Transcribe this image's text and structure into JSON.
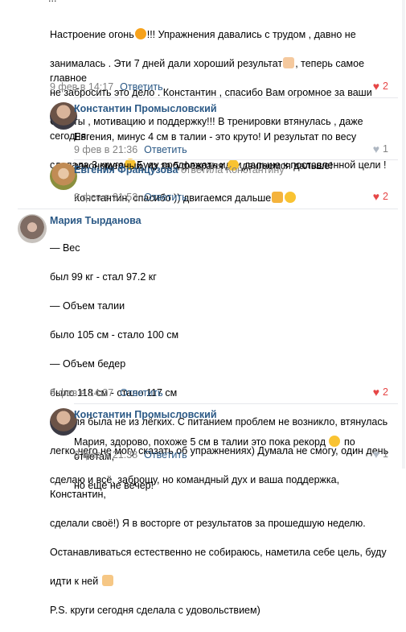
{
  "post_top": {
    "text_fragment": "...",
    "text_lines": [
      "Настроение огонь",
      "!!! Упражнения давались с трудом , давно не",
      "занималась . Эти 7 дней дали хороший результат",
      ", теперь самое главное",
      "не забросить это дело . Константин , спасибо Вам огромное за ваши",
      "Советы , мотивацию и поддержку!!! В тренировки втянулась , даже сегодня",
      "сделала 3 круга",
      "Буду продолжать идти дальше к поставленной цели !"
    ],
    "date": "9 фев в 14:17",
    "reply_label": "Ответить",
    "likes": "2"
  },
  "comment1": {
    "author": "Константин Промысловский",
    "line1": "Евгения, минус 4 см в талии - это круто! И результат по весу",
    "line2a": "закономерный, из за 5 февраля",
    "line2b": "двигаемся дальше!",
    "date": "9 фев в 21:36",
    "reply_label": "Ответить",
    "likes": "1"
  },
  "comment2": {
    "author": "Евгения Французова",
    "replied_to": "ответила Константину",
    "text_a": "Константин, спасибо )) двигаемся дальше",
    "date": "9 фев в 21:53",
    "reply_label": "Ответить",
    "likes": "2"
  },
  "comment3": {
    "author": "Мария Тырданова",
    "lines": [
      "— Вес",
      "был 99 кг - стал 97.2 кг",
      "— Объем талии",
      "было 105 см - стало 100 см",
      "— Объем бедер",
      "было 118 см - стало 117 см",
      "Неделя была не из лёгких. С питанием проблем не возникло, втянулась",
      "легко,чего не могу сказать об упражнениях) Думала не смогу, один день",
      "сделаю и всё, заброшу, но командный дух и ваша поддержка, Константин,",
      "сделали своё!) Я в восторге от результатов за прошедшую неделю.",
      "Останавливаться естественно не собираюсь, наметила себе цель, буду",
      "идти к ней",
      "P.S. круги сегодня сделала с удовольствием)"
    ],
    "date": "9 фев в 14:27",
    "reply_label": "Ответить",
    "likes": "2"
  },
  "comment4": {
    "author": "Константин Промысловский",
    "line1a": "Мария, здорово, похоже 5 см в талии это пока рекорд",
    "line1b": "по отчетам,",
    "line2": "но еще не вечер!",
    "date": "9 фев в 21:38",
    "reply_label": "Ответить",
    "likes": "1"
  },
  "colors": {
    "link": "#2a5885",
    "meta": "#828282",
    "like_active": "#e64646",
    "separator": "#e7e8ec"
  },
  "icons": [
    "heart-icon",
    "fire-emoji",
    "thumbs-up-emoji",
    "grin-emoji",
    "flexed-bicep-emoji",
    "smile-emoji",
    "victory-hand-emoji"
  ]
}
